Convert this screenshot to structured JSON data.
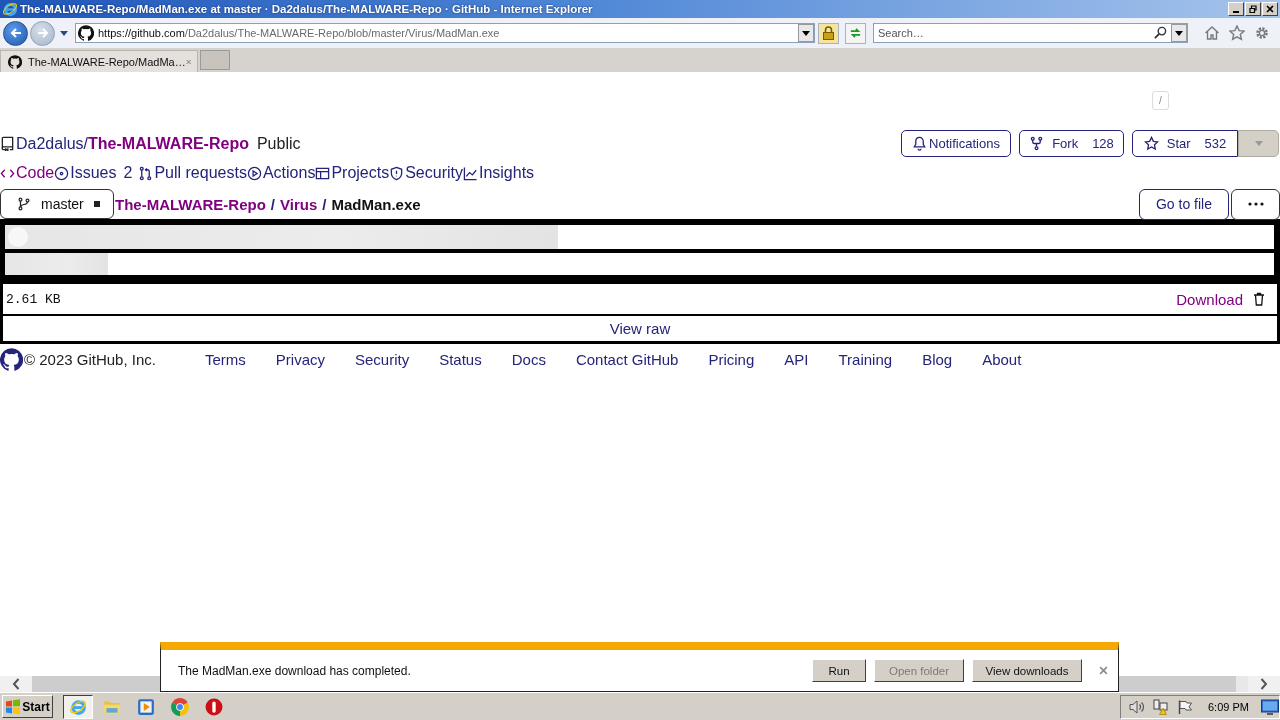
{
  "window": {
    "title": "The-MALWARE-Repo/MadMan.exe at master · Da2dalus/The-MALWARE-Repo · GitHub - Internet Explorer"
  },
  "address_bar": {
    "host": "https://github.com",
    "path": "/Da2dalus/The-MALWARE-Repo/blob/master/Virus/MadMan.exe"
  },
  "search": {
    "placeholder": "Search…"
  },
  "tabs": [
    {
      "label": "The-MALWARE-Repo/MadMa…",
      "selected": true
    }
  ],
  "page": {
    "shortcut_key": "/",
    "repo": {
      "owner": "Da2dalus",
      "separator": "/",
      "name": "The-MALWARE-Repo",
      "visibility": "Public"
    },
    "repo_actions": [
      {
        "label": "Notifications"
      },
      {
        "label": "Fork",
        "count": "128"
      },
      {
        "label": "Star",
        "count": "532"
      }
    ],
    "nav": [
      {
        "label": "Code",
        "selected": true
      },
      {
        "label": "Issues",
        "count": "2",
        "selected": false
      },
      {
        "label": "Pull requests",
        "selected": false
      },
      {
        "label": "Actions",
        "selected": false
      },
      {
        "label": "Projects",
        "selected": false
      },
      {
        "label": "Security",
        "selected": false
      },
      {
        "label": "Insights",
        "selected": false
      }
    ],
    "branch": "master",
    "breadcrumb": [
      {
        "label": "The-MALWARE-Repo",
        "link": true
      },
      {
        "separator": "/",
        "label": "Virus",
        "link": true
      },
      {
        "separator": "/",
        "label": "MadMan.exe",
        "link": false
      }
    ],
    "file_actions": [
      "Go to file"
    ],
    "file": {
      "size": "2.61 KB",
      "download": "Download",
      "view_raw": "View raw"
    },
    "footer": {
      "copyright": "© 2023 GitHub, Inc.",
      "links": [
        "Terms",
        "Privacy",
        "Security",
        "Status",
        "Docs",
        "Contact GitHub",
        "Pricing",
        "API",
        "Training",
        "Blog",
        "About"
      ]
    }
  },
  "download_bar": {
    "message": "The MadMan.exe download has completed.",
    "buttons": [
      {
        "label": "Run",
        "disabled": false
      },
      {
        "label": "Open folder",
        "disabled": true
      },
      {
        "label": "View downloads",
        "disabled": false
      }
    ]
  },
  "taskbar": {
    "start": "Start",
    "apps": [
      {
        "selected": true
      },
      {
        "selected": false
      },
      {
        "selected": false
      },
      {
        "selected": false
      },
      {
        "selected": false
      }
    ],
    "clock": "6:09 PM"
  }
}
